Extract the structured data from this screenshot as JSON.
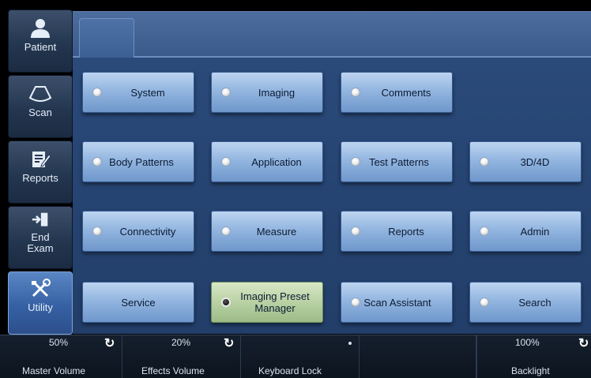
{
  "sidebar": {
    "items": [
      {
        "label": "Patient",
        "icon": "person-icon"
      },
      {
        "label": "Scan",
        "icon": "probe-icon"
      },
      {
        "label": "Reports",
        "icon": "report-edit-icon"
      },
      {
        "label": "End Exam",
        "icon": "exit-door-icon"
      },
      {
        "label": "Utility",
        "icon": "tools-icon",
        "active": true
      }
    ]
  },
  "buttons": {
    "system": "System",
    "imaging": "Imaging",
    "comments": "Comments",
    "body_patterns": "Body Patterns",
    "application": "Application",
    "test_patterns": "Test Patterns",
    "three_d_four_d": "3D/4D",
    "connectivity": "Connectivity",
    "measure": "Measure",
    "reports": "Reports",
    "admin": "Admin",
    "service": "Service",
    "imaging_preset_manager": "Imaging Preset Manager",
    "scan_assistant": "Scan Assistant",
    "search": "Search"
  },
  "selected_button": "imaging_preset_manager",
  "status": {
    "master_volume": {
      "value": "50%",
      "label": "Master Volume"
    },
    "effects_volume": {
      "value": "20%",
      "label": "Effects Volume"
    },
    "keyboard_lock": {
      "label": "Keyboard Lock"
    },
    "backlight": {
      "value": "100%",
      "label": "Backlight"
    }
  },
  "colors": {
    "panel": "#253f66",
    "button": "#93b6e0",
    "selected_button": "#b9d1a4",
    "active_sidebar": "#3561a4"
  }
}
